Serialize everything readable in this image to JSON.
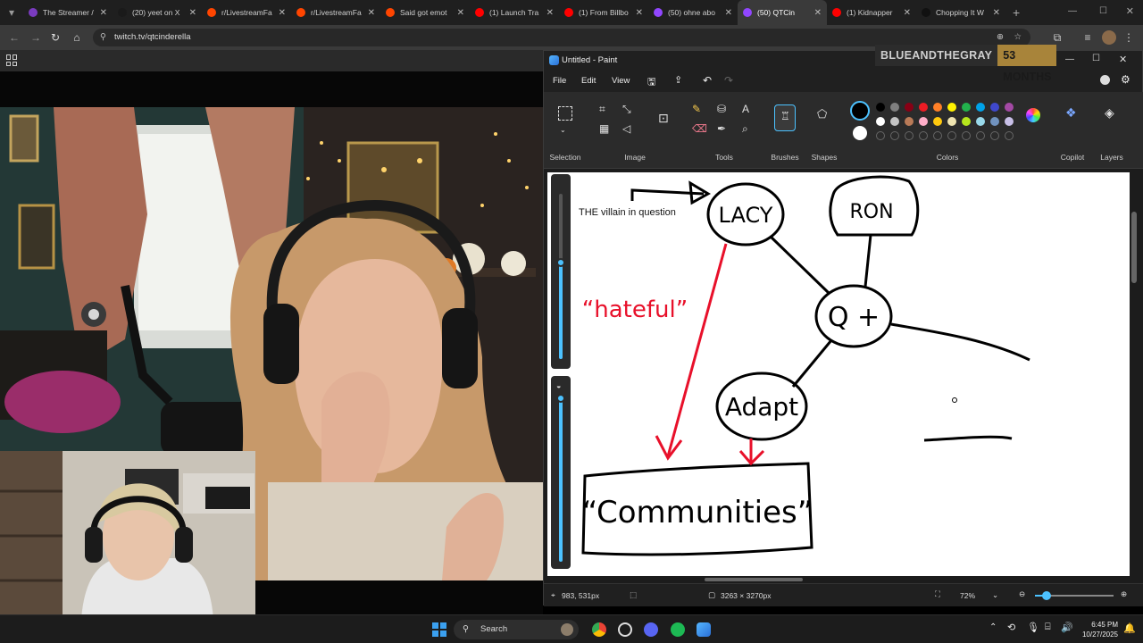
{
  "tabs": [
    {
      "title": "The Streamer /",
      "color": "#7a3bbf"
    },
    {
      "title": "(20) yeet on X",
      "color": "#1a1a1a"
    },
    {
      "title": "r/LivestreamFa",
      "color": "#ff4500"
    },
    {
      "title": "r/LivestreamFa",
      "color": "#ff4500"
    },
    {
      "title": "Said got emot",
      "color": "#ff4500"
    },
    {
      "title": "(1) Launch Tra",
      "color": "#ff0000"
    },
    {
      "title": "(1) From Billbo",
      "color": "#ff0000"
    },
    {
      "title": "(50) ohne abo",
      "color": "#9146ff"
    },
    {
      "title": "(50) QTCin",
      "color": "#9146ff"
    },
    {
      "title": "(1) Kidnapper",
      "color": "#ff0000"
    },
    {
      "title": "Chopping It W",
      "color": "#111111"
    }
  ],
  "address": {
    "url": "twitch.tv/qtcinderella"
  },
  "paint": {
    "title": "Untitled - Paint",
    "menu": {
      "file": "File",
      "edit": "Edit",
      "view": "View"
    },
    "groups": {
      "selection": "Selection",
      "image": "Image",
      "tools": "Tools",
      "brushes": "Brushes",
      "shapes": "Shapes",
      "colors": "Colors",
      "copilot": "Copilot",
      "layers": "Layers"
    },
    "status": {
      "cursor": "983, 531px",
      "size": "3263 × 3270px",
      "zoom": "72%"
    },
    "canvas": {
      "caption": "THE villain in question"
    }
  },
  "sub_badge": {
    "name": "BLUEANDTHEGRAY",
    "months": "53 MONTHS"
  },
  "taskbar": {
    "search": "Search",
    "time": "6:45 PM",
    "date": "10/27/2025"
  },
  "colors": {
    "palette_row1": [
      "#000000",
      "#7f7f7f",
      "#880015",
      "#ed1c24",
      "#ff7f27",
      "#fff200",
      "#22b14c",
      "#00a2e8",
      "#3f48cc",
      "#a349a4"
    ],
    "palette_row2": [
      "#ffffff",
      "#c3c3c3",
      "#b97a57",
      "#ffaec9",
      "#ffc90e",
      "#efe4b0",
      "#b5e61d",
      "#99d9ea",
      "#7092be",
      "#c8bfe7"
    ],
    "ink": "#000000",
    "red_ink": "#e8102a",
    "accent": "#4cc2ff"
  }
}
